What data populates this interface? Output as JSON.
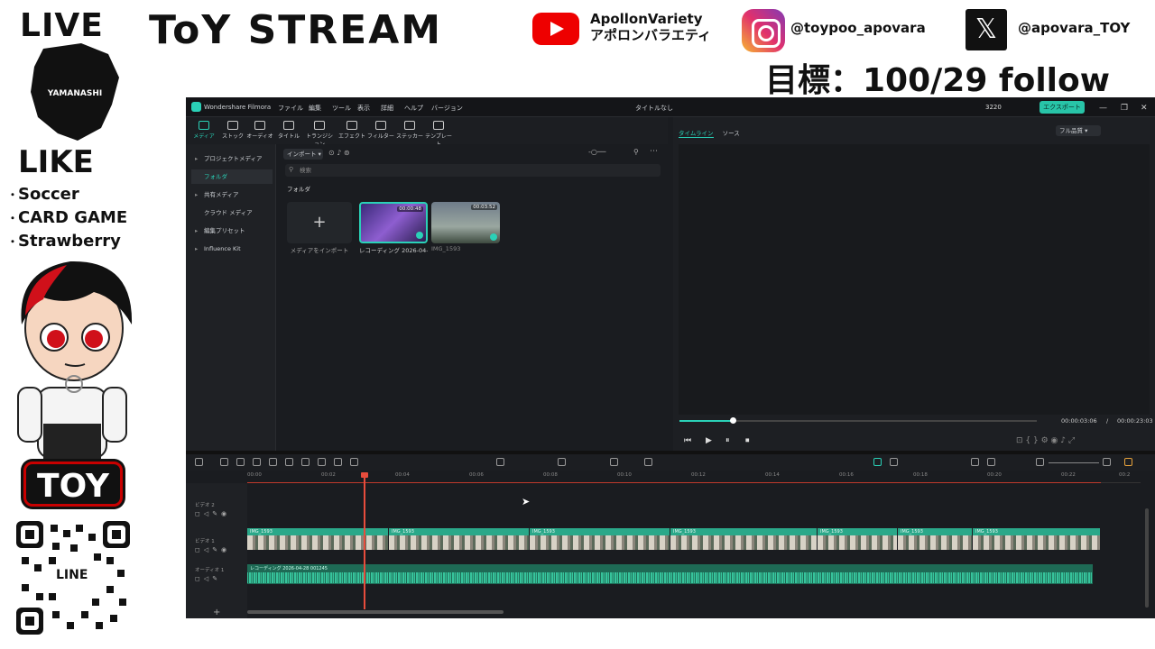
{
  "overlay": {
    "live": "LIVE",
    "region_label": "YAMANASHI",
    "like": "LIKE",
    "likes": [
      "Soccer",
      "CARD GAME",
      "Strawberry"
    ],
    "toy_logo": "TOY",
    "qr_label": "LINE",
    "stream_title": "ToY STREAM",
    "youtube_name_line1": "ApollonVariety",
    "youtube_name_line2": "アポロンバラエティ",
    "instagram_handle": "@toypoo_apovara",
    "x_handle": "@apovara_TOY",
    "x_glyph": "𝕏",
    "goal": "目標：100/29 follow"
  },
  "app": {
    "name": "Wondershare Filmora",
    "menu": [
      "ファイル",
      "編集",
      "ツール",
      "表示",
      "詳細",
      "ヘルプ",
      "バージョン"
    ],
    "doc_title": "タイトルなし",
    "credits": "3220",
    "export_label": "エクスポート",
    "media_tabs": [
      "メディア",
      "ストック",
      "オーディオ",
      "タイトル",
      "トランジション",
      "エフェクト",
      "フィルター",
      "ステッカー",
      "テンプレート"
    ],
    "sidebar": [
      {
        "label": "プロジェクトメディア"
      },
      {
        "label": "フォルダ"
      },
      {
        "label": "共有メディア"
      },
      {
        "label": "クラウド メディア"
      },
      {
        "label": "編集プリセット"
      },
      {
        "label": "Influence Kit"
      }
    ],
    "import_dropdown": "インポート",
    "search_placeholder": "検索",
    "folder_label": "フォルダ",
    "import_media_label": "メディアをインポート",
    "media": [
      {
        "name": "レコーディング 2026-04-2...",
        "duration": "00:00:48"
      },
      {
        "name": "IMG_1593",
        "duration": "00:03:52"
      }
    ],
    "preview_tabs": [
      "タイムライン",
      "ソース"
    ],
    "quality": "フル品質",
    "time_current": "00:00:03:06",
    "time_sep": "/",
    "time_total": "00:00:23:03",
    "player_controls": [
      "⏮",
      "▶",
      "⏸",
      "⏹"
    ],
    "ruler": [
      "00:00",
      "00:02",
      "00:04",
      "00:06",
      "00:08",
      "00:10",
      "00:12",
      "00:14",
      "00:16",
      "00:18",
      "00:20",
      "00:22",
      "00:2"
    ],
    "tracks": {
      "video2": "ビデオ 2",
      "video1": "ビデオ 1",
      "audio1": "オーディオ 1"
    },
    "clip_name": "IMG_1593",
    "audio_clip": "レコーディング 2026-04-28 001245",
    "scrub_progress": 0.15
  }
}
